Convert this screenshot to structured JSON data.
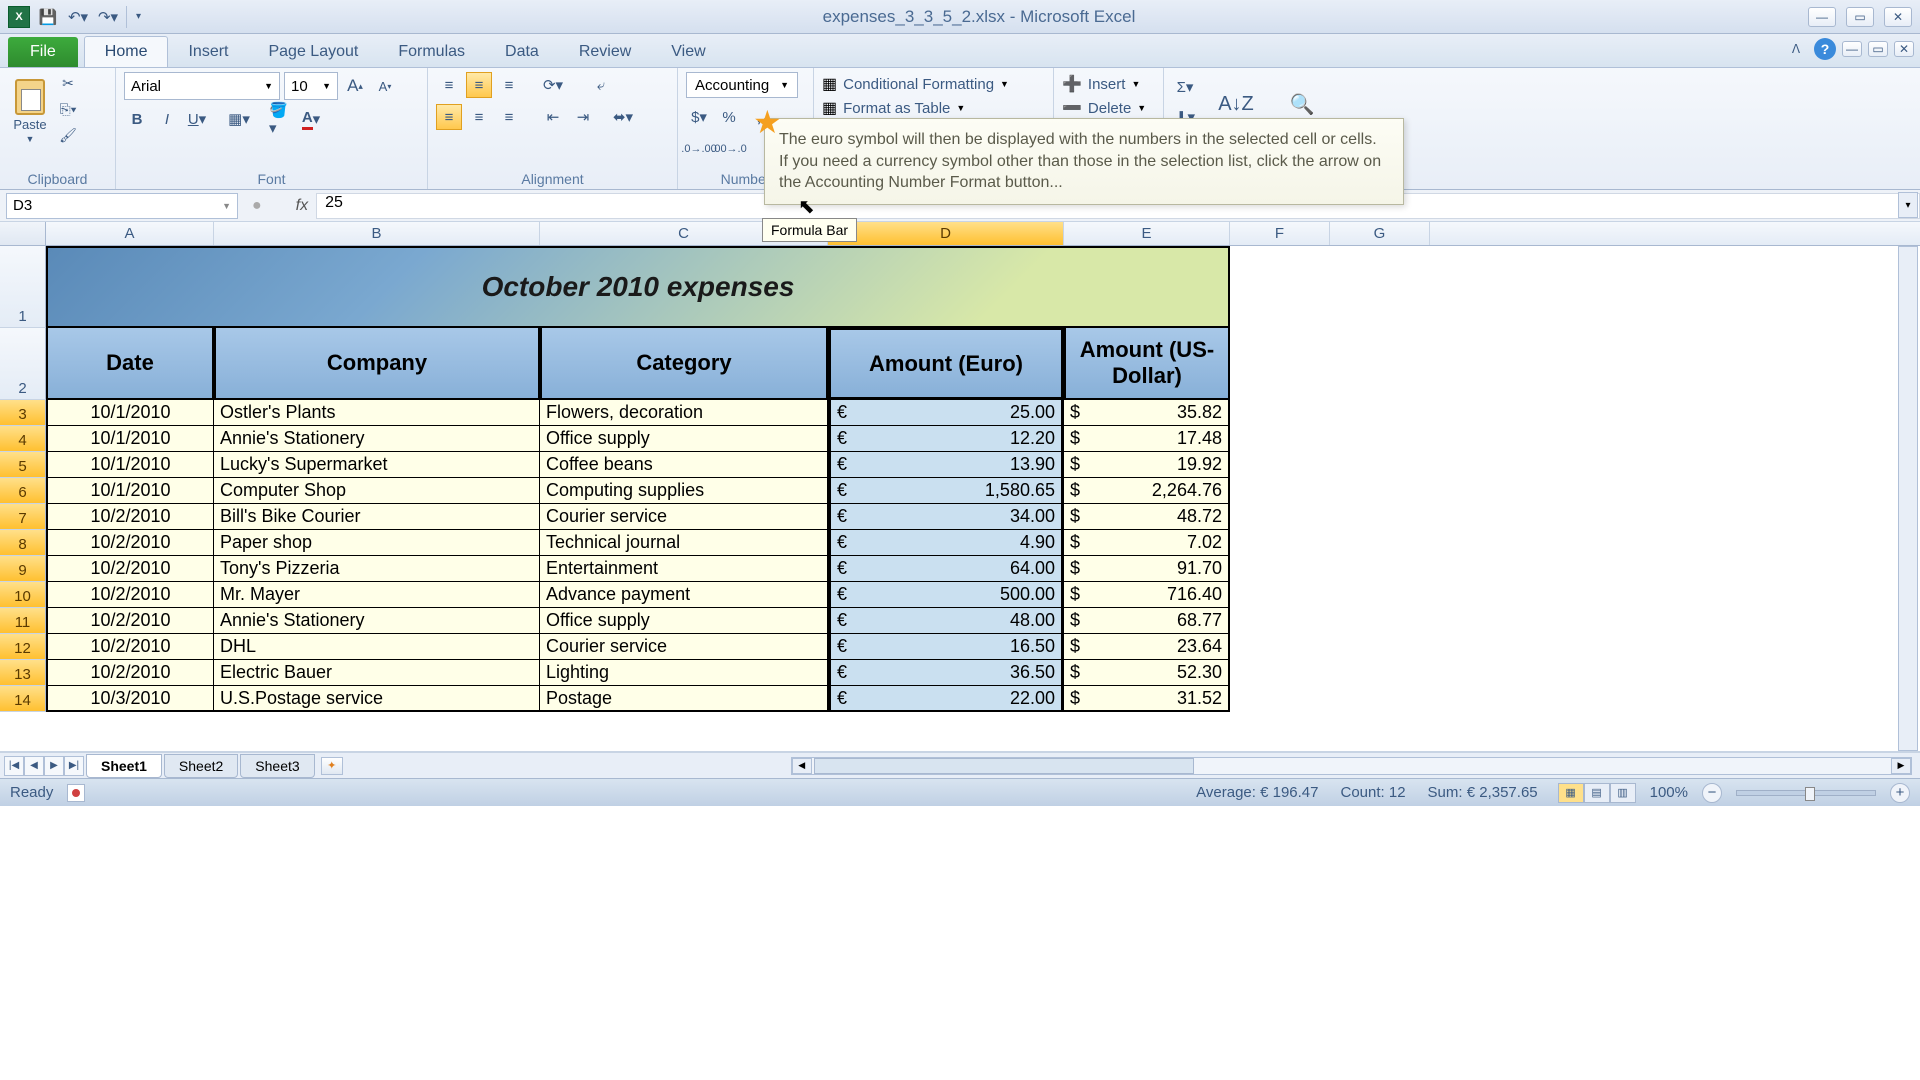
{
  "window_title": "expenses_3_3_5_2.xlsx - Microsoft Excel",
  "tabs": {
    "file": "File",
    "home": "Home",
    "insert": "Insert",
    "page_layout": "Page Layout",
    "formulas": "Formulas",
    "data": "Data",
    "review": "Review",
    "view": "View"
  },
  "clipboard": {
    "paste": "Paste",
    "label": "Clipboard"
  },
  "font": {
    "name": "Arial",
    "size": "10",
    "label": "Font"
  },
  "alignment": {
    "label": "Alignment"
  },
  "number": {
    "format": "Accounting",
    "label": "Number"
  },
  "styles": {
    "cond_fmt": "Conditional Formatting",
    "table": "Format as Table"
  },
  "cells": {
    "insert": "Insert",
    "delete": "Delete"
  },
  "editing": {
    "sort": "Sort &",
    "find": "Find &"
  },
  "tooltip_text": "The euro symbol will then be displayed with the numbers in the selected cell or cells. If you need a currency symbol other than those in the selection list, click the arrow on the Accounting Number Format button...",
  "name_box": "D3",
  "formula_value": "25",
  "formula_bar_tip": "Formula Bar",
  "columns_extra": {
    "F": "F",
    "G": "G"
  },
  "columns": {
    "A": "A",
    "B": "B",
    "C": "C",
    "D": "D",
    "E": "E"
  },
  "sheet_title": "October 2010 expenses",
  "headers": {
    "date": "Date",
    "company": "Company",
    "category": "Category",
    "euro": "Amount (Euro)",
    "usd": "Amount (US-Dollar)"
  },
  "rows": [
    {
      "n": "3",
      "date": "10/1/2010",
      "company": "Ostler's Plants",
      "category": "Flowers, decoration",
      "euro": "25.00",
      "usd": "35.82"
    },
    {
      "n": "4",
      "date": "10/1/2010",
      "company": "Annie's Stationery",
      "category": "Office supply",
      "euro": "12.20",
      "usd": "17.48"
    },
    {
      "n": "5",
      "date": "10/1/2010",
      "company": "Lucky's Supermarket",
      "category": "Coffee beans",
      "euro": "13.90",
      "usd": "19.92"
    },
    {
      "n": "6",
      "date": "10/1/2010",
      "company": "Computer Shop",
      "category": "Computing supplies",
      "euro": "1,580.65",
      "usd": "2,264.76"
    },
    {
      "n": "7",
      "date": "10/2/2010",
      "company": "Bill's Bike Courier",
      "category": "Courier service",
      "euro": "34.00",
      "usd": "48.72"
    },
    {
      "n": "8",
      "date": "10/2/2010",
      "company": "Paper shop",
      "category": "Technical journal",
      "euro": "4.90",
      "usd": "7.02"
    },
    {
      "n": "9",
      "date": "10/2/2010",
      "company": "Tony's Pizzeria",
      "category": "Entertainment",
      "euro": "64.00",
      "usd": "91.70"
    },
    {
      "n": "10",
      "date": "10/2/2010",
      "company": "Mr. Mayer",
      "category": "Advance payment",
      "euro": "500.00",
      "usd": "716.40"
    },
    {
      "n": "11",
      "date": "10/2/2010",
      "company": "Annie's Stationery",
      "category": "Office supply",
      "euro": "48.00",
      "usd": "68.77"
    },
    {
      "n": "12",
      "date": "10/2/2010",
      "company": "DHL",
      "category": "Courier service",
      "euro": "16.50",
      "usd": "23.64"
    },
    {
      "n": "13",
      "date": "10/2/2010",
      "company": "Electric Bauer",
      "category": "Lighting",
      "euro": "36.50",
      "usd": "52.30"
    },
    {
      "n": "14",
      "date": "10/3/2010",
      "company": "U.S.Postage service",
      "category": "Postage",
      "euro": "22.00",
      "usd": "31.52"
    }
  ],
  "row1": "1",
  "row2": "2",
  "sheets": {
    "s1": "Sheet1",
    "s2": "Sheet2",
    "s3": "Sheet3"
  },
  "status": {
    "ready": "Ready",
    "avg": "Average:  € 196.47",
    "count": "Count: 12",
    "sum": "Sum:  € 2,357.65",
    "zoom": "100%"
  }
}
